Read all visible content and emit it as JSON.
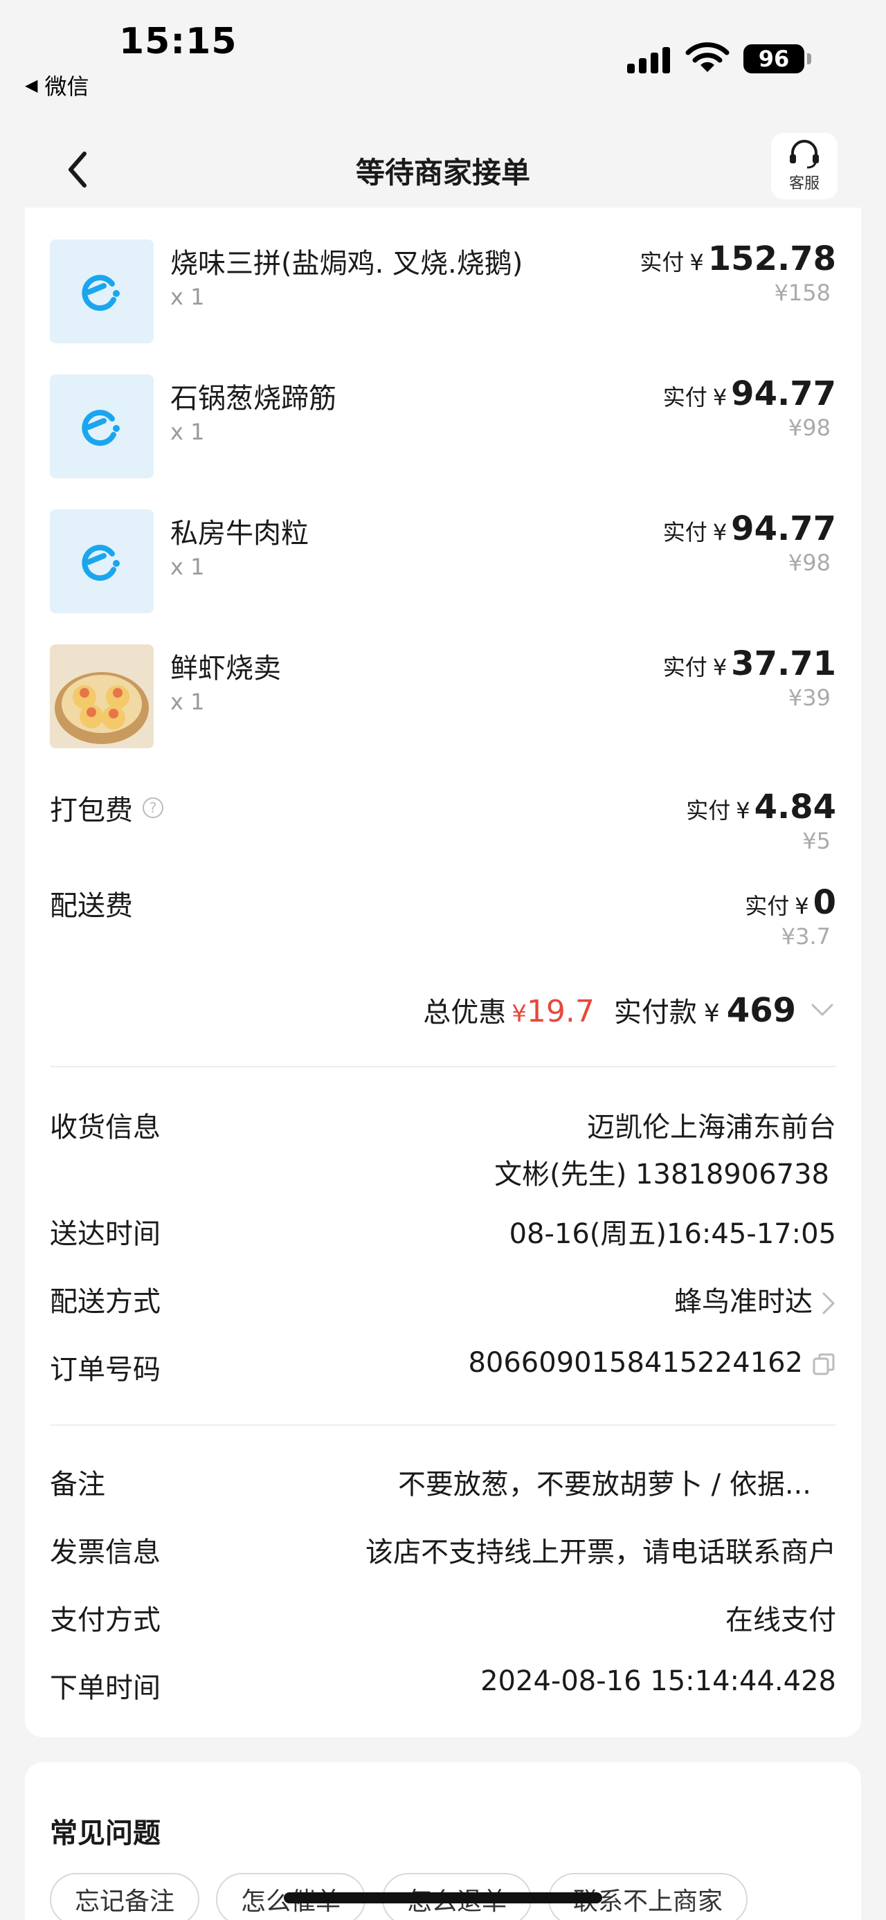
{
  "status_bar": {
    "time": "15:15",
    "back_app": "微信",
    "battery": "96"
  },
  "header": {
    "title": "等待商家接单",
    "service_label": "客服"
  },
  "items": [
    {
      "name": "烧味三拼(盐焗鸡. 叉烧.烧鹅)",
      "qty": "x 1",
      "paid_prefix": "实付",
      "currency": "¥",
      "paid": "152.78",
      "original": "¥158",
      "thumb": "eleme-logo-icon"
    },
    {
      "name": "石锅葱烧蹄筋",
      "qty": "x 1",
      "paid_prefix": "实付",
      "currency": "¥",
      "paid": "94.77",
      "original": "¥98",
      "thumb": "eleme-logo-icon"
    },
    {
      "name": "私房牛肉粒",
      "qty": "x 1",
      "paid_prefix": "实付",
      "currency": "¥",
      "paid": "94.77",
      "original": "¥98",
      "thumb": "eleme-logo-icon"
    },
    {
      "name": "鲜虾烧卖",
      "qty": "x 1",
      "paid_prefix": "实付",
      "currency": "¥",
      "paid": "37.71",
      "original": "¥39",
      "thumb": "shumai-photo"
    }
  ],
  "fees": [
    {
      "label": "打包费",
      "paid_prefix": "实付",
      "currency": "¥",
      "paid": "4.84",
      "original": "¥5",
      "has_help": true
    },
    {
      "label": "配送费",
      "paid_prefix": "实付",
      "currency": "¥",
      "paid": "0",
      "original": "¥3.7",
      "has_help": false
    }
  ],
  "totals": {
    "discount_label": "总优惠",
    "discount_currency": "¥",
    "discount": "19.7",
    "paid_label": "实付款",
    "paid_currency": "¥",
    "paid": "469"
  },
  "delivery_info": [
    {
      "label": "收货信息",
      "value": "迈凯伦上海浦东前台",
      "value2": "文彬(先生) 13818906738"
    },
    {
      "label": "送达时间",
      "value": "08-16(周五)16:45-17:05"
    },
    {
      "label": "配送方式",
      "value": "蜂鸟准时达"
    },
    {
      "label": "订单号码",
      "value": "8066090158415224162"
    }
  ],
  "order_info": [
    {
      "label": "备注",
      "value": "不要放葱，不要放胡萝卜 / 依据..."
    },
    {
      "label": "发票信息",
      "value": "该店不支持线上开票，请电话联系商户"
    },
    {
      "label": "支付方式",
      "value": "在线支付"
    },
    {
      "label": "下单时间",
      "value": "2024-08-16 15:14:44.428"
    }
  ],
  "faq": {
    "title": "常见问题",
    "chips": [
      "忘记备注",
      "怎么催单",
      "怎么退单",
      "联系不上商家"
    ]
  },
  "colors": {
    "accent_blue": "#1aa6ee",
    "discount_red": "#e8473a",
    "background": "#f4f4f5"
  }
}
